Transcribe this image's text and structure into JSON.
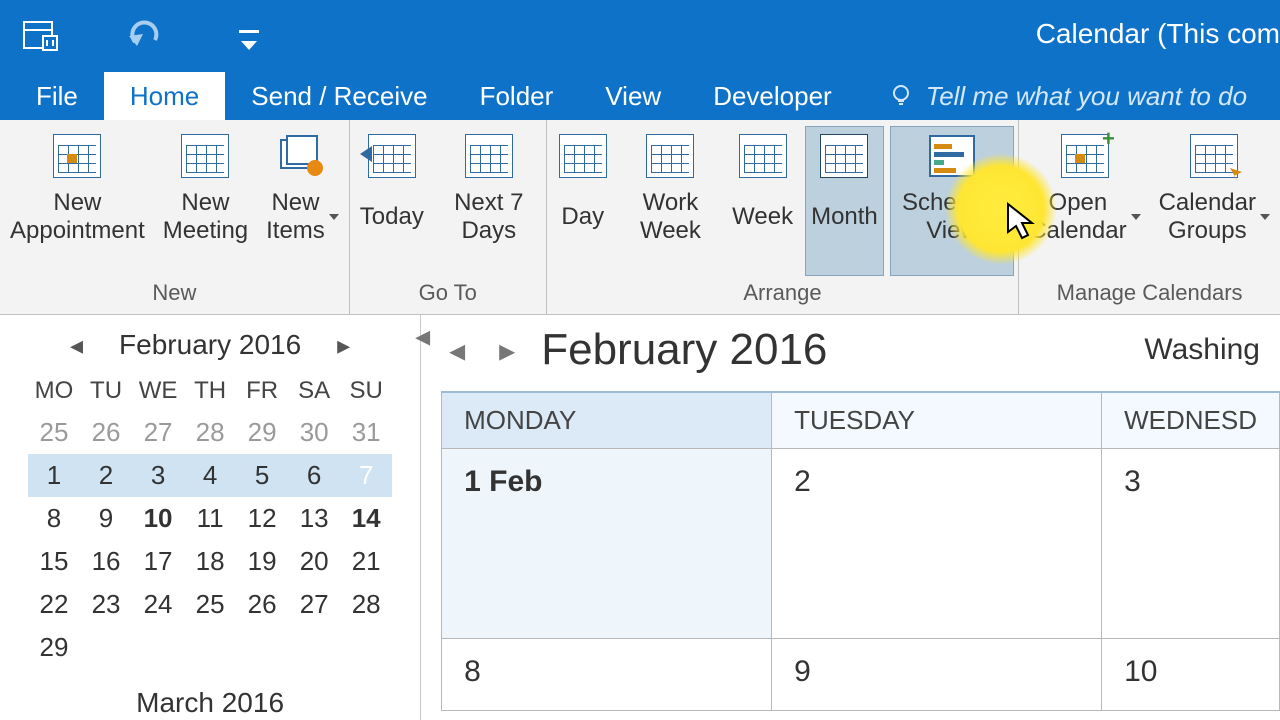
{
  "title": "Calendar (This com",
  "tabs": {
    "file": "File",
    "home": "Home",
    "send_receive": "Send / Receive",
    "folder": "Folder",
    "view": "View",
    "developer": "Developer",
    "tellme": "Tell me what you want to do"
  },
  "ribbon": {
    "new": {
      "appointment": "New Appointment",
      "meeting": "New Meeting",
      "items": "New Items",
      "label": "New"
    },
    "goto": {
      "today": "Today",
      "next7": "Next 7 Days",
      "label": "Go To"
    },
    "arrange": {
      "day": "Day",
      "work_week": "Work Week",
      "week": "Week",
      "month": "Month",
      "schedule_view": "Schedule View",
      "label": "Arrange"
    },
    "manage": {
      "open_calendar": "Open Calendar",
      "calendar_groups": "Calendar Groups",
      "label": "Manage Calendars"
    }
  },
  "mini": {
    "month": "February 2016",
    "dow": [
      "MO",
      "TU",
      "WE",
      "TH",
      "FR",
      "SA",
      "SU"
    ],
    "prev_trail": [
      "25",
      "26",
      "27",
      "28",
      "29",
      "30",
      "31"
    ],
    "weeks": [
      [
        "1",
        "2",
        "3",
        "4",
        "5",
        "6",
        "7"
      ],
      [
        "8",
        "9",
        "10",
        "11",
        "12",
        "13",
        "14"
      ],
      [
        "15",
        "16",
        "17",
        "18",
        "19",
        "20",
        "21"
      ],
      [
        "22",
        "23",
        "24",
        "25",
        "26",
        "27",
        "28"
      ],
      [
        "29"
      ]
    ],
    "selected": "7",
    "bold_days": [
      "10",
      "14"
    ],
    "next_month": "March 2016"
  },
  "main": {
    "month": "February 2016",
    "location": "Washing",
    "columns": [
      "MONDAY",
      "TUESDAY",
      "WEDNESD"
    ],
    "row1": [
      "1 Feb",
      "2",
      "3"
    ],
    "row2": [
      "8",
      "9",
      "10"
    ]
  }
}
